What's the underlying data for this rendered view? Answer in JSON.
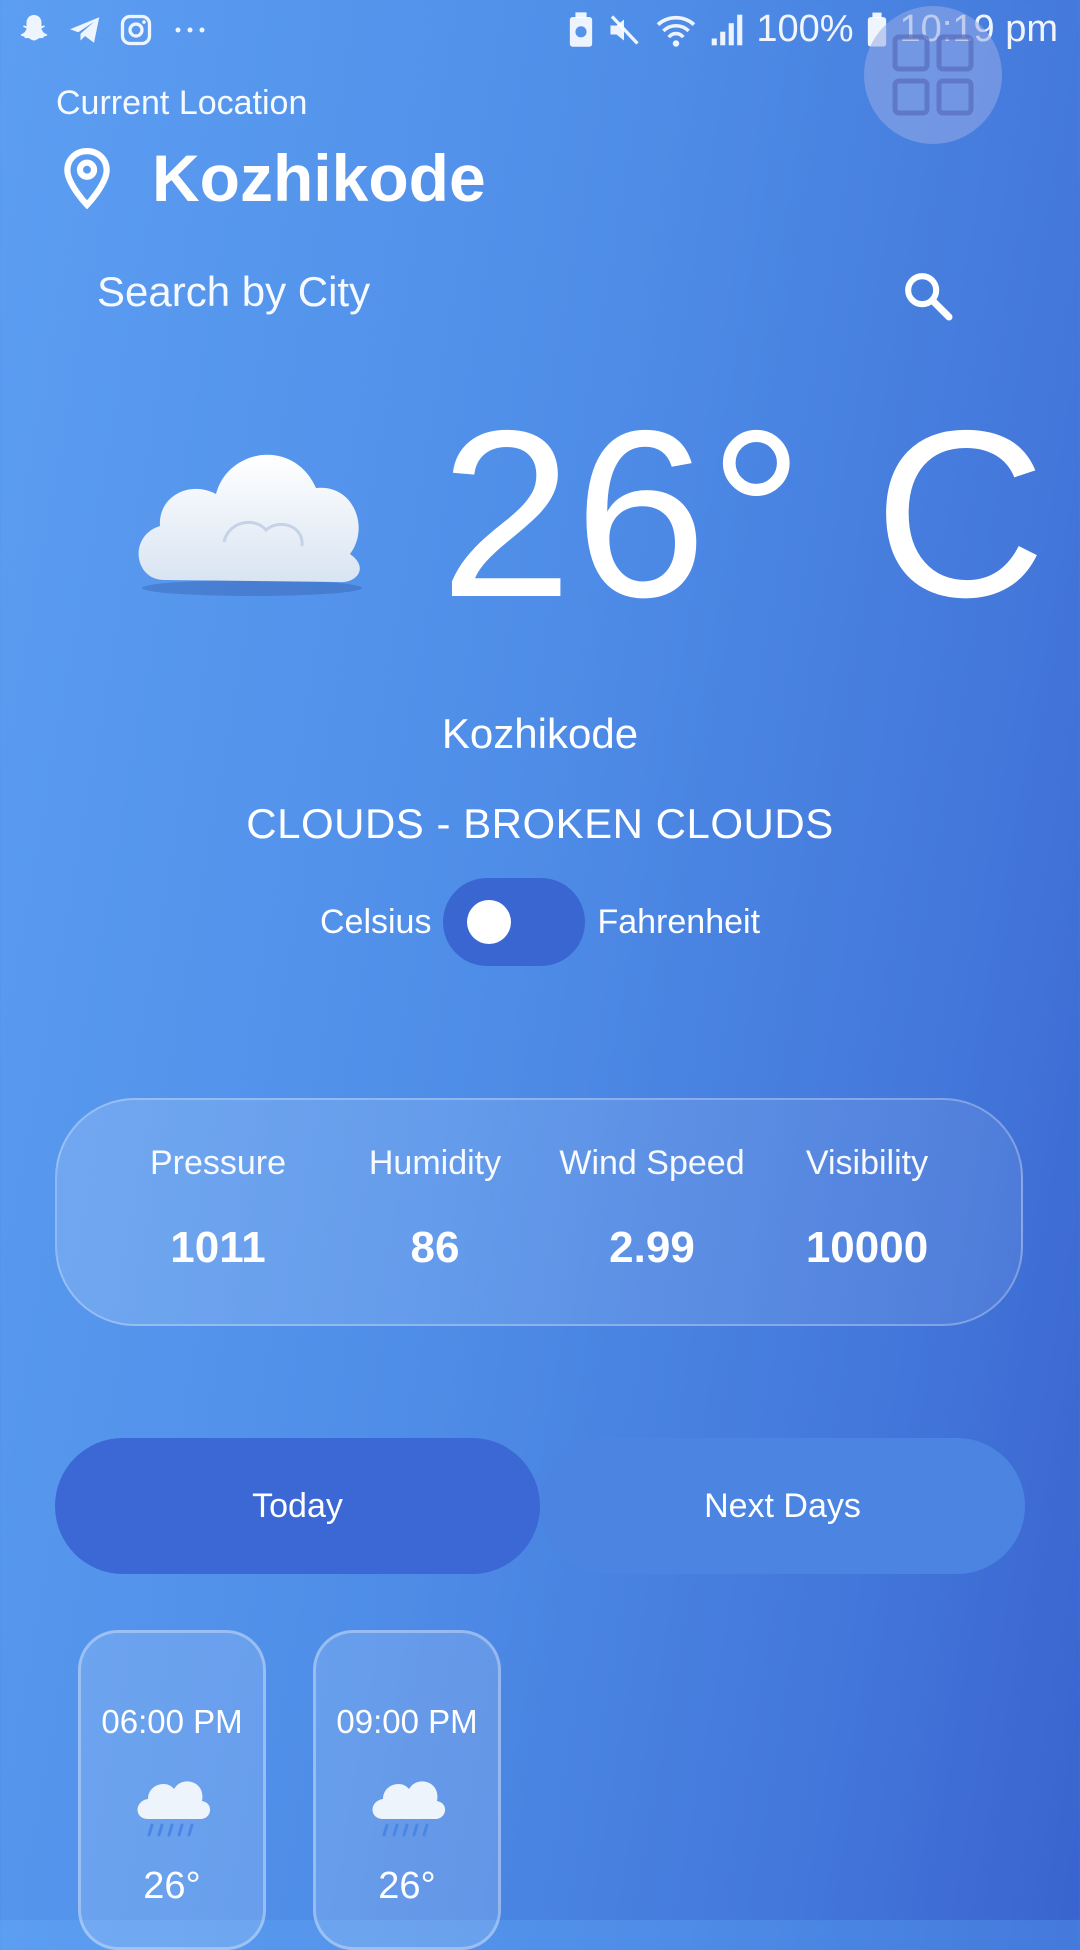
{
  "status_bar": {
    "battery": "100%",
    "time": "10:19 pm",
    "icons": [
      "snapchat-icon",
      "telegram-icon",
      "instagram-icon",
      "more-dots-icon",
      "battery-saver-icon",
      "mute-icon",
      "wifi-icon",
      "signal-icon",
      "battery-icon"
    ]
  },
  "header": {
    "label": "Current Location",
    "city": "Kozhikode",
    "icon": "location-pin-icon"
  },
  "search": {
    "placeholder": "Search by City",
    "icon": "search-icon"
  },
  "current": {
    "temperature": "26° C",
    "city": "Kozhikode",
    "description": "CLOUDS - BROKEN CLOUDS",
    "icon": "cloud-icon"
  },
  "units": {
    "left": "Celsius",
    "right": "Fahrenheit",
    "selected": "Celsius"
  },
  "stats": [
    {
      "label": "Pressure",
      "value": "1011"
    },
    {
      "label": "Humidity",
      "value": "86"
    },
    {
      "label": "Wind Speed",
      "value": "2.99"
    },
    {
      "label": "Visibility",
      "value": "10000"
    }
  ],
  "tabs": [
    {
      "label": "Today",
      "active": true
    },
    {
      "label": "Next Days",
      "active": false
    }
  ],
  "hourly": [
    {
      "time": "06:00 PM",
      "temp": "26°",
      "icon": "rain-cloud-icon"
    },
    {
      "time": "09:00 PM",
      "temp": "26°",
      "icon": "rain-cloud-icon"
    }
  ],
  "colors": {
    "background_start": "#5c9ef2",
    "background_end": "#3964cf",
    "active_tab": "#3b68d4",
    "inactive_tab": "#4c84e2",
    "toggle_track": "#3a66d1"
  }
}
